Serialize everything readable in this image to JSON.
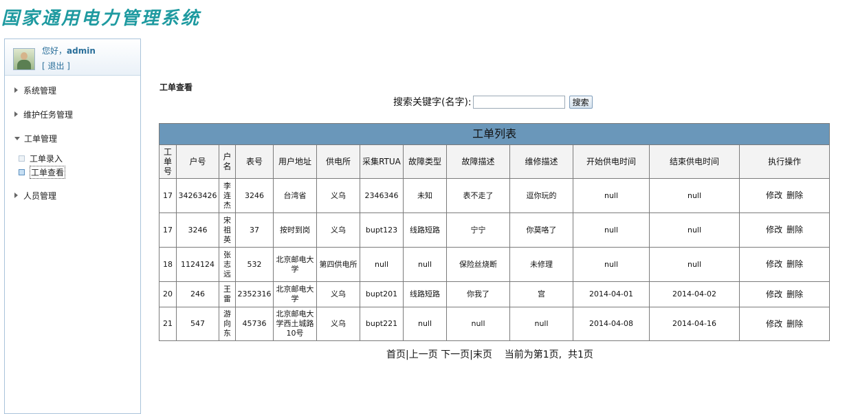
{
  "app_title": "国家通用电力管理系统",
  "user": {
    "greeting": "您好，",
    "name": "admin",
    "logout": "[ 退出 ]"
  },
  "menu": {
    "system": "系统管理",
    "maintenance": "维护任务管理",
    "workorder": "工单管理",
    "workorder_sub": {
      "entry": "工单录入",
      "view": "工单查看"
    },
    "personnel": "人员管理"
  },
  "page_title": "工单查看",
  "search": {
    "label": "搜索关键字(名字):",
    "value": "",
    "button": "搜索"
  },
  "table": {
    "caption": "工单列表",
    "headers": [
      "工单号",
      "户号",
      "户名",
      "表号",
      "用户地址",
      "供电所",
      "采集RTUA",
      "故障类型",
      "故障描述",
      "维修描述",
      "开始供电时间",
      "结束供电时间",
      "执行操作"
    ],
    "rows": [
      [
        "17",
        "34263426",
        "李连杰",
        "3246",
        "台湾省",
        "义乌",
        "2346346",
        "未知",
        "表不走了",
        "逗你玩的",
        "null",
        "null"
      ],
      [
        "17",
        "3246",
        "宋祖英",
        "37",
        "按时到岗",
        "义乌",
        "bupt123",
        "线路短路",
        "宁宁",
        "你莫咯了",
        "null",
        "null"
      ],
      [
        "18",
        "1124124",
        "张志远",
        "532",
        "北京邮电大学",
        "第四供电所",
        "null",
        "null",
        "保险丝烧断",
        "未修理",
        "null",
        "null"
      ],
      [
        "20",
        "246",
        "王雷",
        "2352316",
        "北京邮电大学",
        "义乌",
        "bupt201",
        "线路短路",
        "你我了",
        "宫",
        "2014-04-01",
        "2014-04-02"
      ],
      [
        "21",
        "547",
        "游向东",
        "45736",
        "北京邮电大学西土城路10号",
        "义乌",
        "bupt221",
        "null",
        "null",
        "null",
        "2014-04-08",
        "2014-04-16"
      ]
    ],
    "actions": {
      "edit": "修改",
      "delete": "删除"
    }
  },
  "pager": {
    "first": "首页",
    "sep1": "|",
    "prev": "上一页",
    "next": "下一页",
    "sep2": "|",
    "last": "末页",
    "status": "当前为第1页,  共1页"
  }
}
